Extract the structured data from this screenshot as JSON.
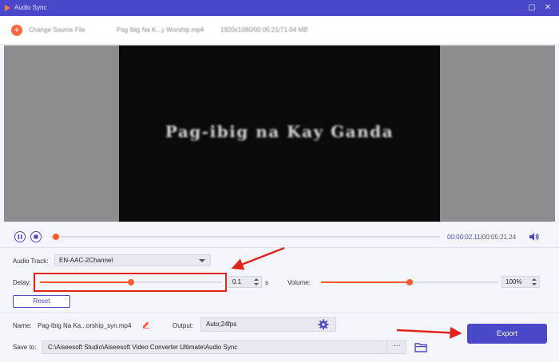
{
  "titlebar": {
    "title": "Audio Sync"
  },
  "header": {
    "change_source_label": "Change Source File",
    "source_name": "Pag Ibig Na K...y Worship.mp4",
    "source_info": "1920x1080/00:05:21/71.04 MB"
  },
  "preview": {
    "caption": "Pag-ibig na Kay Ganda"
  },
  "playback": {
    "current_time": "00:00:02.11",
    "separator": "/",
    "total_time": "00:05:21.24"
  },
  "audio_track": {
    "label": "Audio Track:",
    "value": "EN-AAC-2Channel"
  },
  "delay": {
    "label": "Delay:",
    "value": "0.1",
    "unit": "s",
    "slider_fraction": 0.5
  },
  "volume": {
    "label": "Volume:",
    "value": "100%",
    "slider_fraction": 0.5
  },
  "reset_label": "Reset",
  "output_name": {
    "label": "Name:",
    "value": "Pag-Ibig Na Ka...orship_syn.mp4"
  },
  "output": {
    "label": "Output:",
    "value": "Auto;24fps"
  },
  "save_to": {
    "label": "Save to:",
    "path": "C:\\Aiseesoft Studio\\Aiseesoft Video Converter Ultimate\\Audio Sync",
    "browse_label": "···"
  },
  "export_label": "Export",
  "colors": {
    "accent": "#4a47c9",
    "slider": "#ff5a2e",
    "annotation": "#e2231a"
  }
}
